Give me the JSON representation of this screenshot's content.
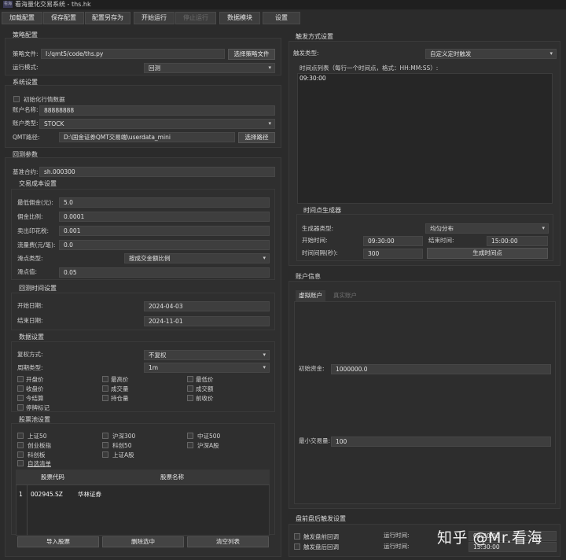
{
  "window": {
    "logo_text": "看海",
    "title": "看海量化交易系统 - ths.hk"
  },
  "toolbar": {
    "load_config": "加载配置",
    "save_config": "保存配置",
    "save_config_as": "配置另存为",
    "start_run": "开始运行",
    "stop_run": "停止运行",
    "data_module": "数据模块",
    "settings": "设置"
  },
  "strategy": {
    "title": "策略配置",
    "file_label": "策略文件:",
    "file_value": "I:/qmt5/code/ths.py",
    "select_file_button": "选择策略文件",
    "mode_label": "运行模式:",
    "mode_value": "回测"
  },
  "system": {
    "title": "系统设置",
    "init_market_label": "初始化行情数据",
    "account_name_label": "账户名称:",
    "account_name_value": "88888888",
    "account_type_label": "账户类型:",
    "account_type_value": "STOCK",
    "qmt_path_label": "QMT路径:",
    "qmt_path_value": "D:\\国金证券QMT交易端\\userdata_mini",
    "select_path_button": "选择路径"
  },
  "backtest": {
    "title": "回测参数",
    "benchmark_label": "基准合约:",
    "benchmark_value": "sh.000300",
    "cost_title": "交易成本设置",
    "min_commission_label": "最低佣金(元):",
    "min_commission_value": "5.0",
    "commission_rate_label": "佣金比例:",
    "commission_rate_value": "0.0001",
    "stamp_tax_label": "卖出印花税:",
    "stamp_tax_value": "0.001",
    "flow_fee_label": "流量费(元/笔):",
    "flow_fee_value": "0.0",
    "slippage_type_label": "滑点类型:",
    "slippage_type_value": "按成交金额比例",
    "slippage_value_label": "滑点值:",
    "slippage_value": "0.05",
    "time_title": "回测时间设置",
    "start_date_label": "开始日期:",
    "start_date_value": "2024-04-03",
    "end_date_label": "结束日期:",
    "end_date_value": "2024-11-01",
    "data_title": "数据设置",
    "adjust_label": "复权方式:",
    "adjust_value": "不复权",
    "period_label": "周期类型:",
    "period_value": "1m",
    "fields": [
      "开盘价",
      "最高价",
      "最低价",
      "收盘价",
      "成交量",
      "成交额",
      "今结算",
      "持仓量",
      "前收价",
      "停牌标记"
    ],
    "pool_title": "股票池设置",
    "pools": [
      "上证50",
      "沪深300",
      "中证500",
      "创业板指",
      "科创50",
      "沪深A股",
      "科创板",
      "上证A股"
    ],
    "custom_list": "自选清单",
    "table_headers": [
      "股票代码",
      "股票名称"
    ],
    "table_rows": [
      {
        "index": "1",
        "code": "002945.SZ",
        "name": "华林证券"
      }
    ],
    "import_button": "导入股票",
    "delete_button": "删除选中",
    "clear_button": "清空列表"
  },
  "trigger": {
    "title": "触发方式设置",
    "type_label": "触发类型:",
    "type_value": "自定义定时触发",
    "list_label": "时间点列表（每行一个时间点，格式：HH:MM:SS）:",
    "list_value": "09:30:00",
    "generator_title": "时间点生成器",
    "gen_type_label": "生成器类型:",
    "gen_type_value": "均匀分布",
    "start_label": "开始时间:",
    "start_value": "09:30:00",
    "end_label": "结束时间:",
    "end_value": "15:00:00",
    "interval_label": "时间间隔(秒):",
    "interval_value": "300",
    "generate_button": "生成时间点"
  },
  "account": {
    "title": "账户信息",
    "tab_virtual": "虚拟账户",
    "tab_real": "真实账户",
    "initial_capital_label": "初始资金:",
    "initial_capital_value": "1000000.0",
    "min_volume_label": "最小交易量:",
    "min_volume_value": "100"
  },
  "prepost": {
    "title": "盘前盘后触发设置",
    "pre_label": "触发盘前回调",
    "post_label": "触发盘后回调",
    "run_time_label_1": "运行时间:",
    "run_time_label_2": "运行时间:",
    "pre_time": "08:30:00",
    "post_time": "15:30:00"
  },
  "watermark": "知乎 @Mr.看海"
}
